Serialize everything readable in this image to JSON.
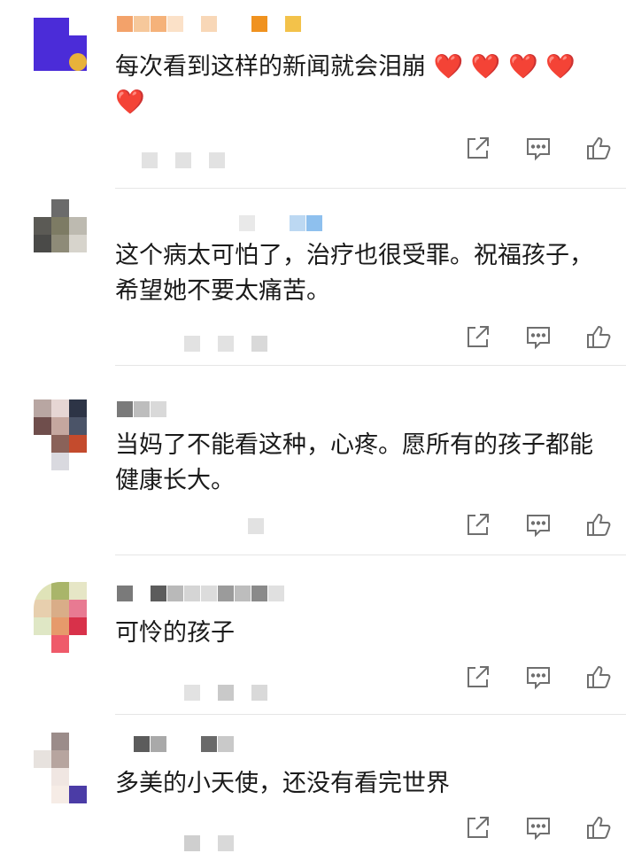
{
  "comments": [
    {
      "text": "每次看到这样的新闻就会泪崩 ❤️ ❤️ ❤️ ❤️ ❤️"
    },
    {
      "text": "这个病太可怕了，治疗也很受罪。祝福孩子，希望她不要太痛苦。"
    },
    {
      "text": "当妈了不能看这种，心疼。愿所有的孩子都能健康长大。"
    },
    {
      "text": "可怜的孩子"
    },
    {
      "text": "多美的小天使，还没有看完世界"
    }
  ],
  "icons": {
    "share": "share-icon",
    "reply": "comment-icon",
    "like": "thumbs-up-icon"
  },
  "colors": {
    "icon": "#6f6f6f",
    "heart": "#e0262b"
  }
}
